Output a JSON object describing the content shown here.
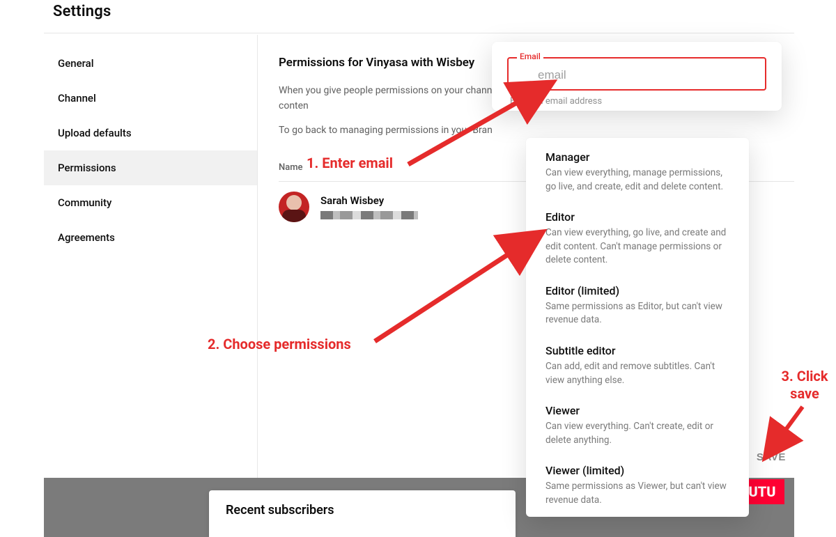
{
  "page_title": "Settings",
  "sidebar": {
    "items": [
      {
        "label": "General"
      },
      {
        "label": "Channel"
      },
      {
        "label": "Upload defaults"
      },
      {
        "label": "Permissions"
      },
      {
        "label": "Community"
      },
      {
        "label": "Agreements"
      }
    ],
    "active_index": 3
  },
  "content": {
    "heading": "Permissions for Vinyasa with Wisbey",
    "desc1": "When you give people permissions on your channel, actions. They can also view private or hidden conten",
    "desc2": "To go back to managing permissions in your Bran",
    "column_name": "Name",
    "user": {
      "name": "Sarah Wisbey"
    }
  },
  "modal": {
    "email_label": "Email",
    "email_placeholder": "email",
    "helper": "Enter an email address"
  },
  "roles": [
    {
      "title": "Manager",
      "desc": "Can view everything, manage permissions, go live, and create, edit and delete content."
    },
    {
      "title": "Editor",
      "desc": "Can view everything, go live, and create and edit content. Can't manage permissions or delete content."
    },
    {
      "title": "Editor (limited)",
      "desc": "Same permissions as Editor, but can't view revenue data."
    },
    {
      "title": "Subtitle editor",
      "desc": "Can add, edit and remove subtitles. Can't view anything else."
    },
    {
      "title": "Viewer",
      "desc": "Can view everything. Can't create, edit or delete anything."
    },
    {
      "title": "Viewer (limited)",
      "desc": "Same permissions as Viewer, but can't view revenue data."
    }
  ],
  "save_label": "SAVE",
  "bottom": {
    "card_title": "Recent subscribers",
    "logo_text": "UTU"
  },
  "annotations": {
    "a1": "1. Enter email",
    "a2": "2. Choose permissions",
    "a3": "3. Click save"
  }
}
